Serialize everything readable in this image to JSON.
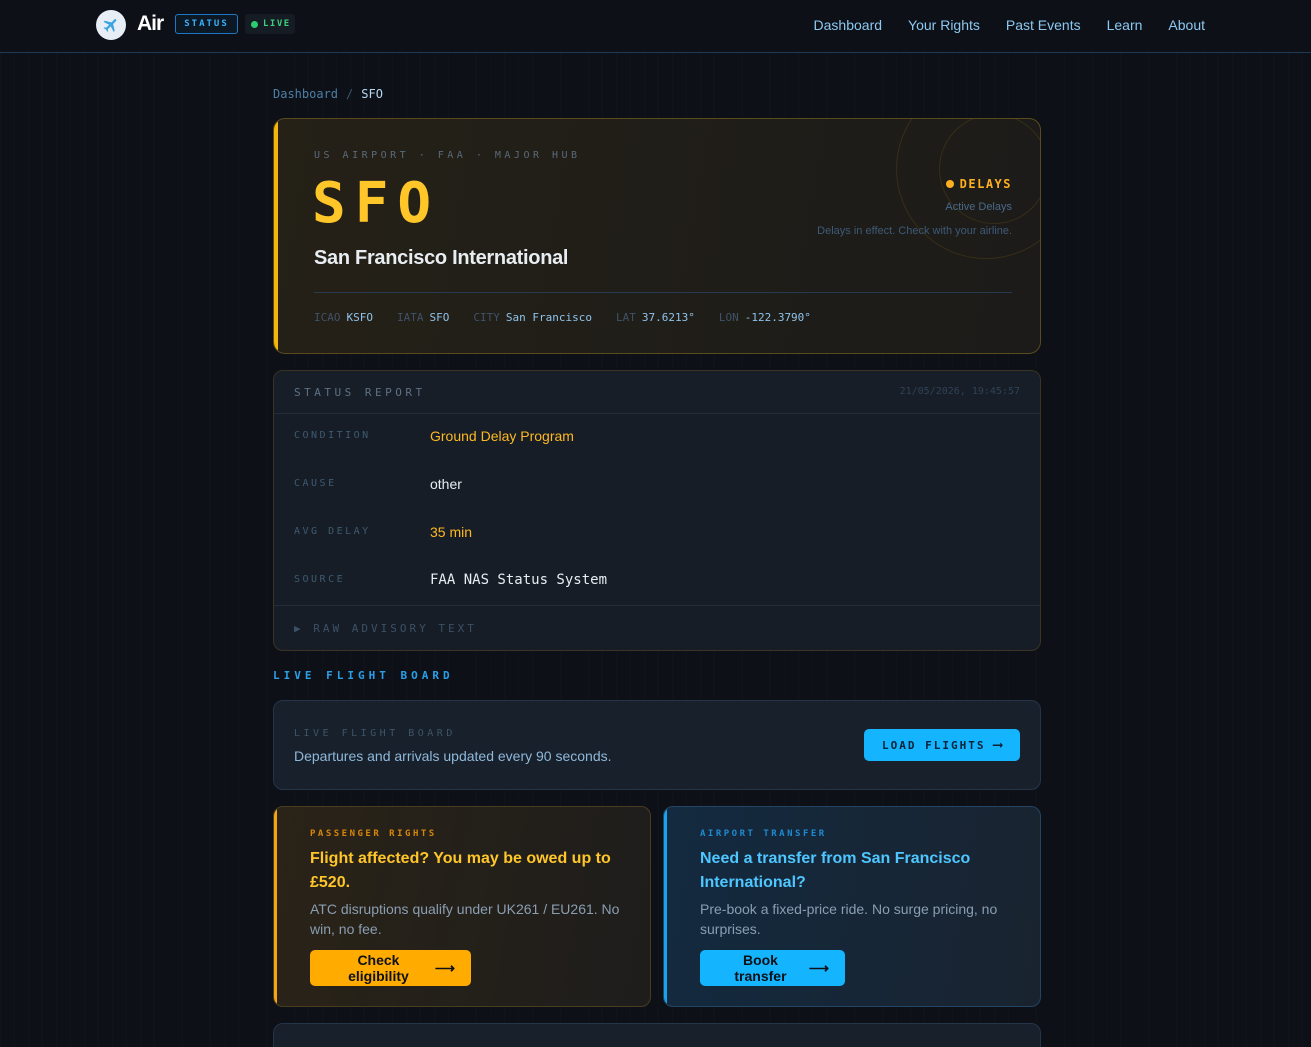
{
  "nav": {
    "logo_text": "Air",
    "status_badge": "STATUS",
    "live_badge": "LIVE",
    "links": [
      "Dashboard",
      "Your Rights",
      "Past Events",
      "Learn",
      "About"
    ]
  },
  "breadcrumb": {
    "parent": "Dashboard",
    "separator": "/",
    "current": "SFO"
  },
  "airport": {
    "subtitle": "US AIRPORT · FAA · MAJOR HUB",
    "code": "SFO",
    "name": "San Francisco International",
    "status_label": "DELAYS",
    "status_sub": "Active Delays",
    "status_desc": "Delays in effect. Check with your airline.",
    "meta": [
      {
        "key": "ICAO",
        "value": "KSFO"
      },
      {
        "key": "IATA",
        "value": "SFO"
      },
      {
        "key": "CITY",
        "value": "San Francisco"
      },
      {
        "key": "LAT",
        "value": "37.6213°"
      },
      {
        "key": "LON",
        "value": "-122.3790°"
      }
    ]
  },
  "report": {
    "title": "STATUS REPORT",
    "timestamp": "21/05/2026, 19:45:57",
    "rows": [
      {
        "key": "CONDITION",
        "value": "Ground Delay Program"
      },
      {
        "key": "CAUSE",
        "value": "other"
      },
      {
        "key": "AVG DELAY",
        "value": "35 min"
      },
      {
        "key": "SOURCE",
        "value": "FAA NAS Status System"
      }
    ],
    "raw_label": "RAW ADVISORY TEXT",
    "raw_arrow": "▶"
  },
  "flight_board": {
    "section_title": "LIVE FLIGHT BOARD",
    "label": "LIVE FLIGHT BOARD",
    "description": "Departures and arrivals updated every 90 seconds.",
    "button_label": "LOAD FLIGHTS",
    "button_arrow": "⟶"
  },
  "promos": {
    "rights": {
      "kicker": "PASSENGER RIGHTS",
      "title": "Flight affected? You may be owed up to £520.",
      "body": "ATC disruptions qualify under UK261 / EU261. No win, no fee.",
      "button_label": "Check eligibility",
      "button_arrow": "⟶"
    },
    "transfer": {
      "kicker": "AIRPORT TRANSFER",
      "title": "Need a transfer from San Francisco International?",
      "body": "Pre-book a fixed-price ride. No surge pricing, no surprises.",
      "button_label": "Book transfer",
      "button_arrow": "⟶"
    }
  },
  "colors": {
    "accent_yellow": "#ffc629",
    "accent_blue": "#14b4ff",
    "live_green": "#2ecc71",
    "background": "#0d1117"
  },
  "icons": {
    "logo": "airplane-icon",
    "live": "live-dot-icon",
    "status": "status-dot-icon"
  }
}
